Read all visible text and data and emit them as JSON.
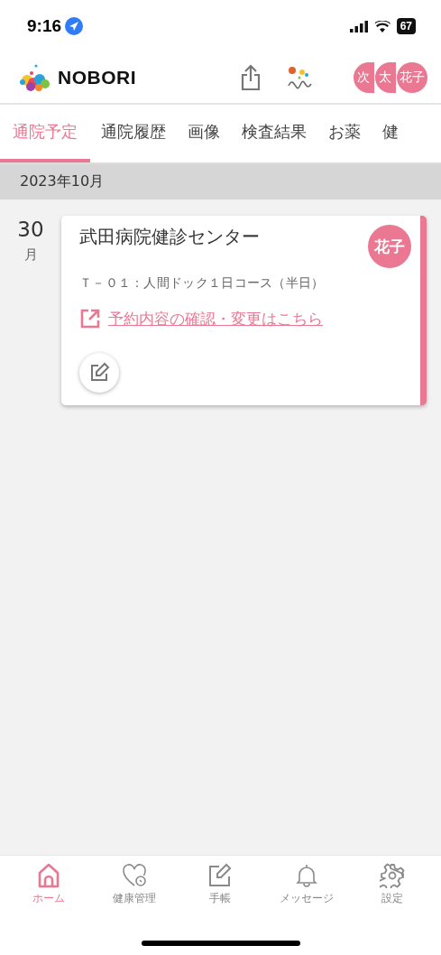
{
  "status_bar": {
    "time": "9:16",
    "battery": "67"
  },
  "header": {
    "logo": "NOBORI",
    "members": [
      {
        "label": "次"
      },
      {
        "label": "太"
      },
      {
        "label": "花子"
      }
    ]
  },
  "tabs": [
    {
      "label": "通院予定",
      "selected": true
    },
    {
      "label": "通院履歴",
      "selected": false
    },
    {
      "label": "画像",
      "selected": false
    },
    {
      "label": "検査結果",
      "selected": false
    },
    {
      "label": "お薬",
      "selected": false
    },
    {
      "label": "健",
      "selected": false
    }
  ],
  "month": "2023年10月",
  "appointments": [
    {
      "day": "30",
      "weekday": "月",
      "hospital": "武田病院健診センター",
      "member": "花子",
      "course": "Ｔ－０１：人間ドック１日コース（半日）",
      "link": "予約内容の確認・変更はこちら"
    }
  ],
  "bottom_nav": [
    {
      "kind": "home",
      "label": "ホーム",
      "selected": true
    },
    {
      "kind": "health",
      "label": "健康管理",
      "selected": false
    },
    {
      "kind": "notebook",
      "label": "手帳",
      "selected": false
    },
    {
      "kind": "bell",
      "label": "メッセージ",
      "selected": false
    },
    {
      "kind": "gear",
      "label": "設定",
      "selected": false
    }
  ]
}
